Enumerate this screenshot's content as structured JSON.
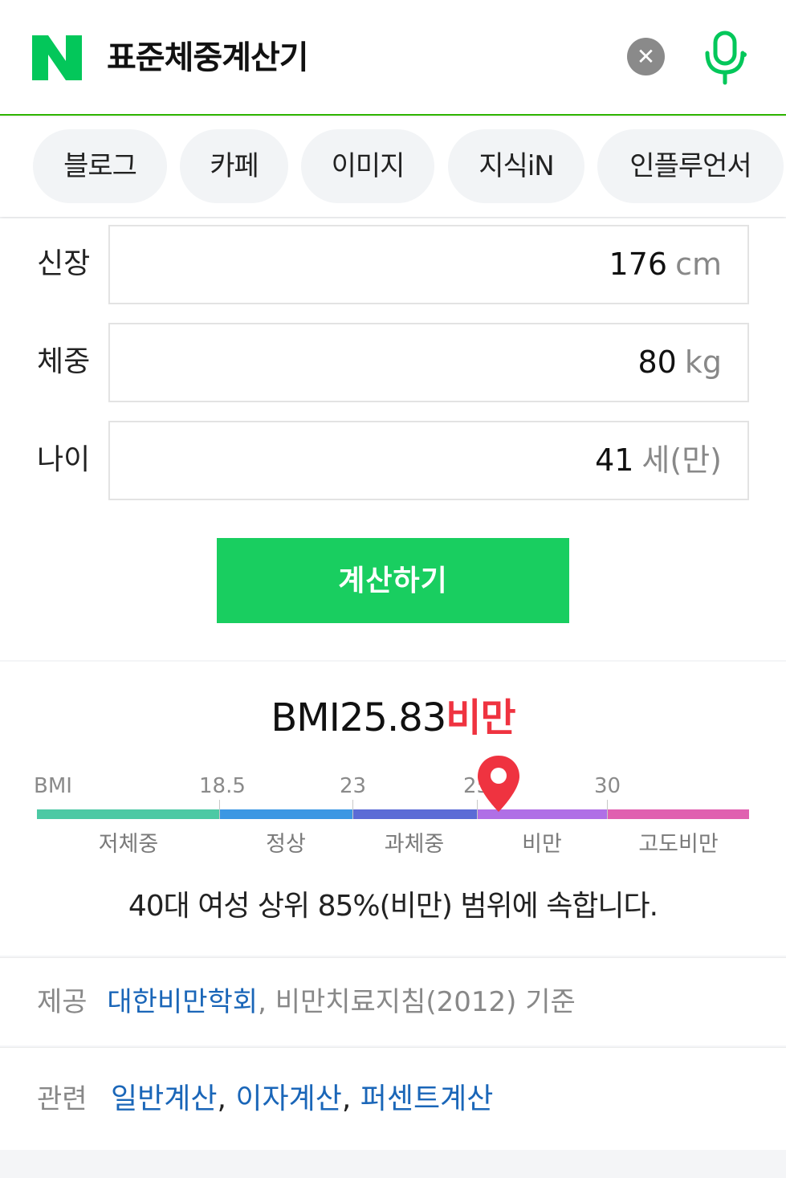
{
  "search": {
    "query": "표준체중계산기",
    "clear_icon": "close-icon",
    "mic_icon": "microphone-icon",
    "brand_color": "#03c75a"
  },
  "tabs": [
    "블로그",
    "카페",
    "이미지",
    "지식iN",
    "인플루언서"
  ],
  "calculator": {
    "height": {
      "label": "신장",
      "value": "176",
      "unit": "cm"
    },
    "weight": {
      "label": "체중",
      "value": "80",
      "unit": "kg"
    },
    "age": {
      "label": "나이",
      "value": "41",
      "unit": "세(만)"
    },
    "button": "계산하기",
    "button_color": "#19ce60"
  },
  "result": {
    "bmi_label": "BMI",
    "bmi_value": "25.83",
    "status": "비만",
    "status_color": "#ef3340",
    "scale": {
      "axis_label": "BMI",
      "ticks": [
        "18.5",
        "23",
        "25",
        "30"
      ],
      "categories": [
        {
          "label": "저체중",
          "color": "#4cc9a4"
        },
        {
          "label": "정상",
          "color": "#3b97e3"
        },
        {
          "label": "과체중",
          "color": "#5b6bd6"
        },
        {
          "label": "비만",
          "color": "#b06fe6"
        },
        {
          "label": "고도비만",
          "color": "#e060b0"
        }
      ],
      "marker_value": 25.83
    },
    "description": "40대 여성 상위 85%(비만) 범위에 속합니다."
  },
  "provider": {
    "label": "제공",
    "source_link": "대한비만학회",
    "comma": ",",
    "basis": "비만치료지침(2012) 기준"
  },
  "related": {
    "label": "관련",
    "links": [
      "일반계산",
      "이자계산",
      "퍼센트계산"
    ]
  }
}
